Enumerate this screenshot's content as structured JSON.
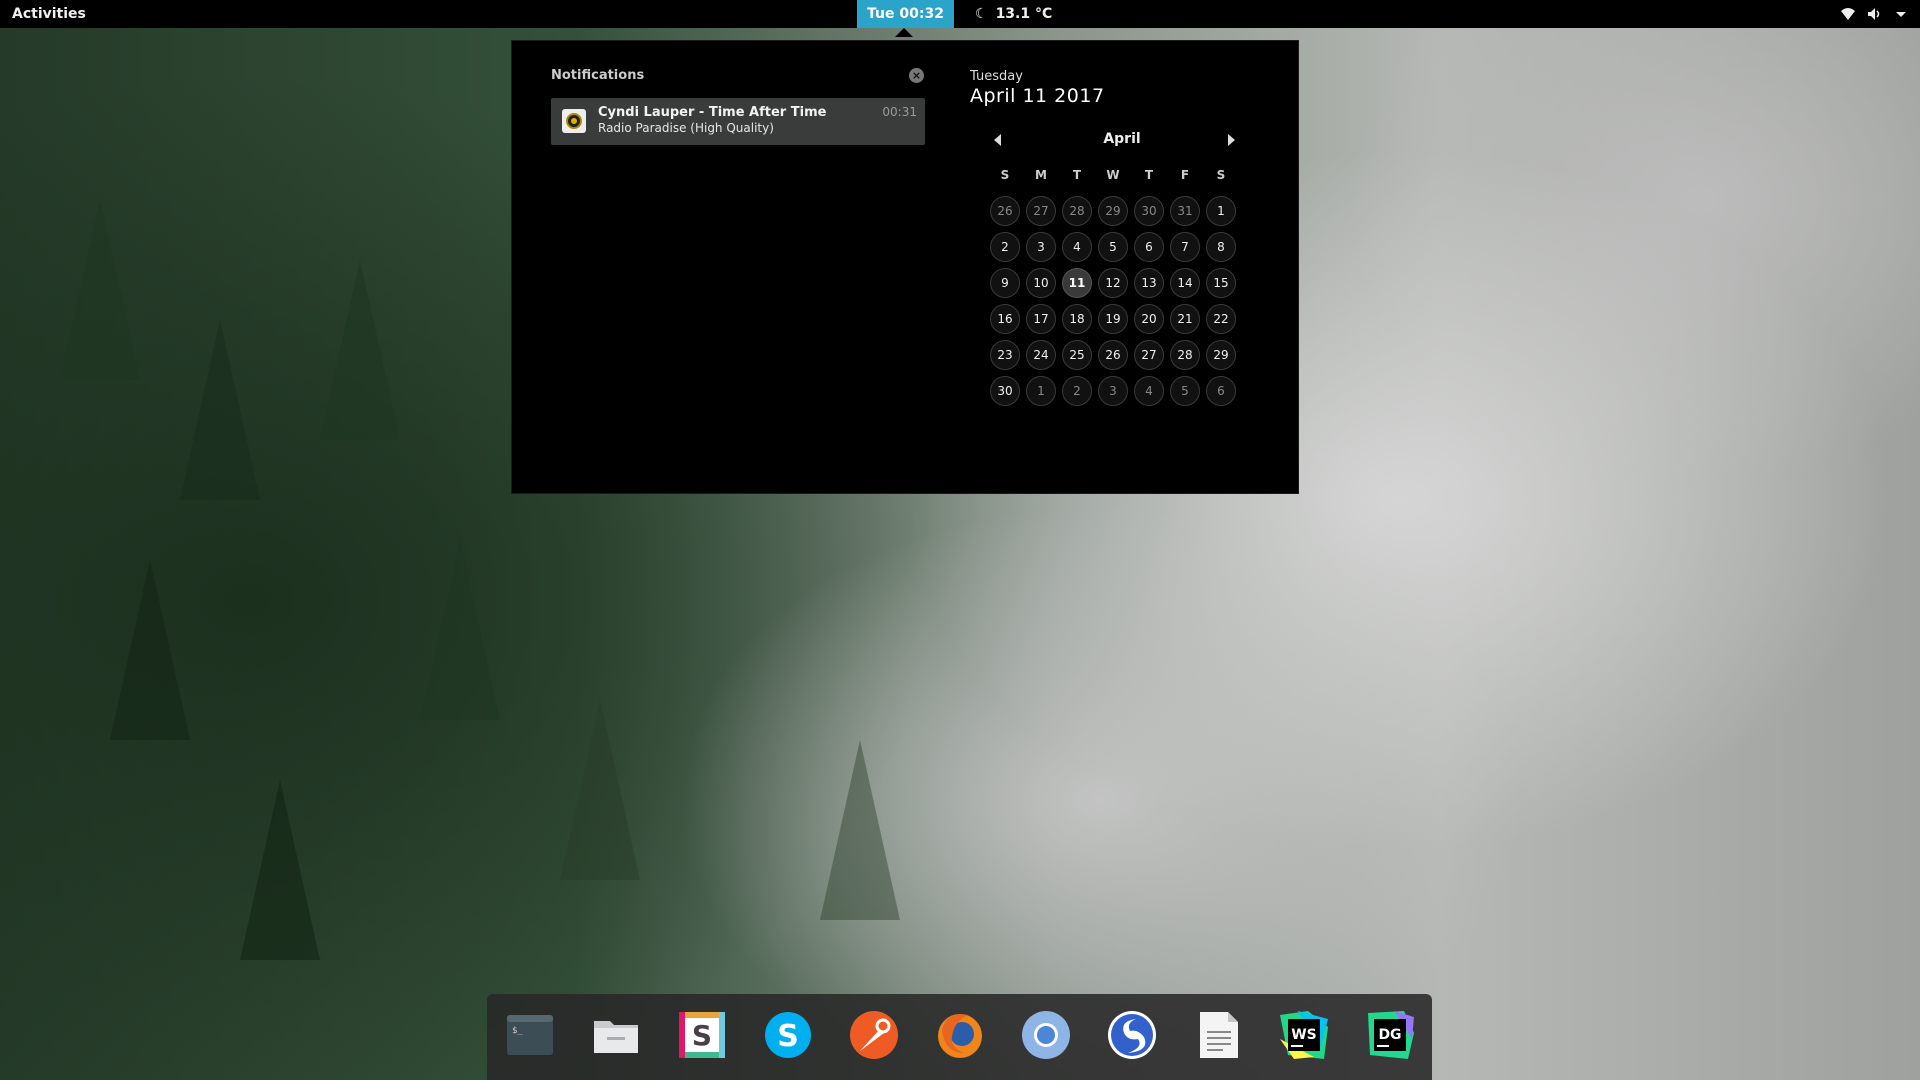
{
  "topbar": {
    "activities": "Activities",
    "clock": "Tue 00:32",
    "weather": "13.1 °C",
    "tray_icons": [
      "wifi-icon",
      "volume-icon",
      "system-menu-arrow-icon"
    ]
  },
  "notifications": {
    "title": "Notifications",
    "items": [
      {
        "title": "Cyndi Lauper - Time After Time",
        "subtitle": "Radio Paradise (High Quality)",
        "time": "00:31",
        "icon": "rhythmbox-icon"
      }
    ]
  },
  "calendar": {
    "weekday": "Tuesday",
    "date": "April 11 2017",
    "month": "April",
    "weekdays": [
      "S",
      "M",
      "T",
      "W",
      "T",
      "F",
      "S"
    ],
    "days": [
      "26",
      "27",
      "28",
      "29",
      "30",
      "31",
      "1",
      "2",
      "3",
      "4",
      "5",
      "6",
      "7",
      "8",
      "9",
      "10",
      "11",
      "12",
      "13",
      "14",
      "15",
      "16",
      "17",
      "18",
      "19",
      "20",
      "21",
      "22",
      "23",
      "24",
      "25",
      "26",
      "27",
      "28",
      "29",
      "30",
      "1",
      "2",
      "3",
      "4",
      "5",
      "6"
    ],
    "today": "11"
  },
  "dock": {
    "apps": [
      "terminal-icon",
      "files-icon",
      "slack-icon",
      "skype-icon",
      "postman-icon",
      "firefox-icon",
      "chromium-icon",
      "simplenote-icon",
      "text-editor-icon",
      "webstorm-icon",
      "datagrip-icon"
    ]
  },
  "colors": {
    "accent": "#2aa4c8",
    "popup_bg": "#000000",
    "card_bg": "#3a3c3c"
  }
}
